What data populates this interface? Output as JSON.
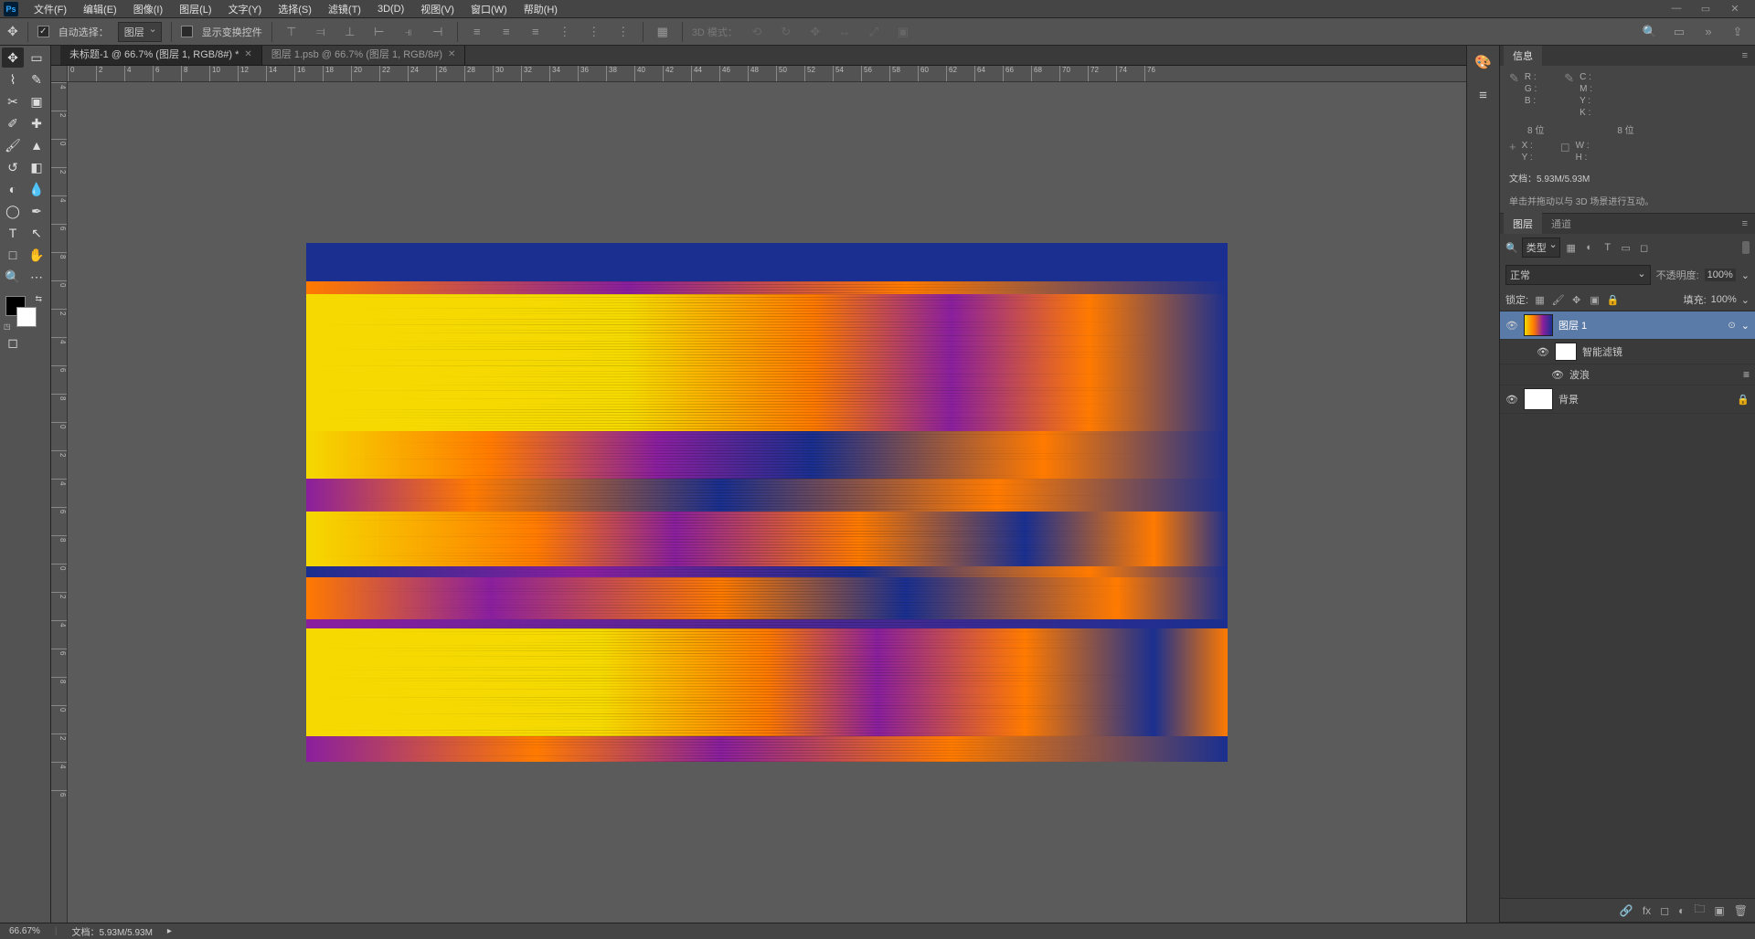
{
  "menu": {
    "items": [
      "文件(F)",
      "编辑(E)",
      "图像(I)",
      "图层(L)",
      "文字(Y)",
      "选择(S)",
      "滤镜(T)",
      "3D(D)",
      "视图(V)",
      "窗口(W)",
      "帮助(H)"
    ]
  },
  "optbar": {
    "auto_select_label": "自动选择：",
    "auto_select_target": "图层",
    "show_transform_label": "显示变换控件",
    "mode3d_label": "3D 模式："
  },
  "tabs": [
    {
      "title": "未标题-1 @ 66.7% (图层 1, RGB/8#) *",
      "active": true
    },
    {
      "title": "图层 1.psb @ 66.7% (图层 1, RGB/8#)",
      "active": false
    }
  ],
  "ruler_h": [
    "0",
    "2",
    "4",
    "6",
    "8",
    "10",
    "12",
    "14",
    "16",
    "18",
    "20",
    "22",
    "24",
    "26",
    "28",
    "30",
    "32",
    "34",
    "36",
    "38",
    "40",
    "42",
    "44",
    "46",
    "48",
    "50",
    "52",
    "54",
    "56",
    "58",
    "60",
    "62",
    "64",
    "66",
    "68",
    "70",
    "72",
    "74",
    "76"
  ],
  "ruler_v": [
    "4",
    "2",
    "0",
    "2",
    "4",
    "6",
    "8",
    "0",
    "2",
    "4",
    "6",
    "8",
    "0",
    "2",
    "4",
    "6",
    "8",
    "0",
    "2",
    "4",
    "6",
    "8",
    "0",
    "2",
    "4",
    "6"
  ],
  "info": {
    "tab": "信息",
    "rgb": {
      "R": "R :",
      "G": "G :",
      "B": "B :"
    },
    "cmyk": {
      "C": "C :",
      "M": "M :",
      "Y": "Y :",
      "K": "K :"
    },
    "bits1": "8 位",
    "bits2": "8 位",
    "xy": {
      "X": "X :",
      "Y": "Y :"
    },
    "wh": {
      "W": "W :",
      "H": "H :"
    },
    "doc": "文档：5.93M/5.93M",
    "hint": "单击并拖动以与 3D 场景进行互动。"
  },
  "layers_panel": {
    "tab_layers": "图层",
    "tab_channels": "通道",
    "filter_label": "类型",
    "blend_mode": "正常",
    "opacity_label": "不透明度:",
    "opacity_value": "100%",
    "lock_label": "锁定:",
    "fill_label": "填充:",
    "fill_value": "100%",
    "layers": [
      {
        "name": "图层 1",
        "smart": true
      },
      {
        "name": "智能滤镜",
        "kind": "fx-group"
      },
      {
        "name": "波浪",
        "kind": "fx"
      },
      {
        "name": "背景",
        "locked": true
      }
    ]
  },
  "status": {
    "zoom": "66.67%",
    "doc": "文档：5.93M/5.93M"
  },
  "colors": {
    "blue": "#1a2f8f",
    "yellow": "#f5d900",
    "orange": "#ff7a00",
    "purple": "#8a1f9e"
  }
}
